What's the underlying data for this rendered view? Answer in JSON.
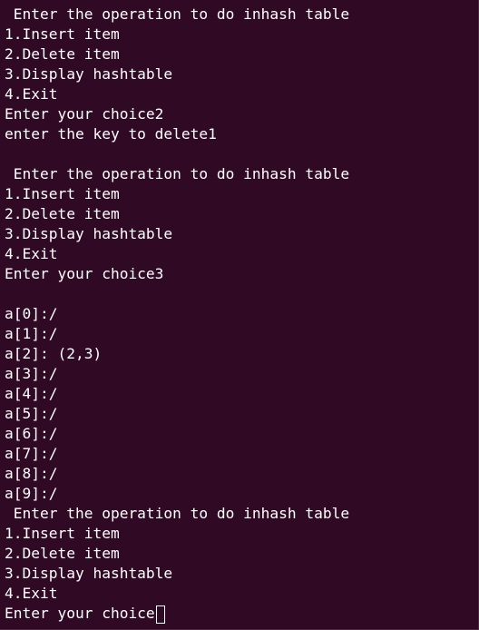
{
  "terminal": {
    "lines": [
      " Enter the operation to do inhash table",
      "1.Insert item",
      "2.Delete item",
      "3.Display hashtable",
      "4.Exit",
      "Enter your choice2",
      "enter the key to delete1",
      "",
      " Enter the operation to do inhash table",
      "1.Insert item",
      "2.Delete item",
      "3.Display hashtable",
      "4.Exit",
      "Enter your choice3",
      "",
      "a[0]:/",
      "a[1]:/",
      "a[2]: (2,3)",
      "a[3]:/",
      "a[4]:/",
      "a[5]:/",
      "a[6]:/",
      "a[7]:/",
      "a[8]:/",
      "a[9]:/",
      " Enter the operation to do inhash table",
      "1.Insert item",
      "2.Delete item",
      "3.Display hashtable",
      "4.Exit"
    ],
    "prompt": "Enter your choice",
    "colors": {
      "background": "#300a24",
      "text": "#ffffff"
    }
  }
}
